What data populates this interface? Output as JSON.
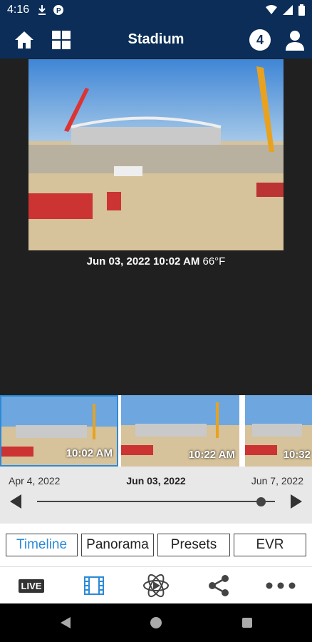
{
  "status": {
    "time": "4:16"
  },
  "header": {
    "title": "Stadium",
    "badge": "4"
  },
  "viewer": {
    "date": "Jun 03, 2022 10:02 AM",
    "temp": "66°F"
  },
  "thumbs": [
    {
      "label": "10:02 AM"
    },
    {
      "label": "10:22 AM"
    },
    {
      "label": "10:32"
    }
  ],
  "timeline": {
    "start": "Apr 4, 2022",
    "current": "Jun 03, 2022",
    "end": "Jun 7, 2022",
    "position": 0.94
  },
  "tabs": {
    "timeline": "Timeline",
    "panorama": "Panorama",
    "presets": "Presets",
    "evr": "EVR"
  },
  "toolbar": {
    "live": "LIVE"
  },
  "colors": {
    "header": "#0b2d57",
    "accent": "#2b8ad8"
  }
}
